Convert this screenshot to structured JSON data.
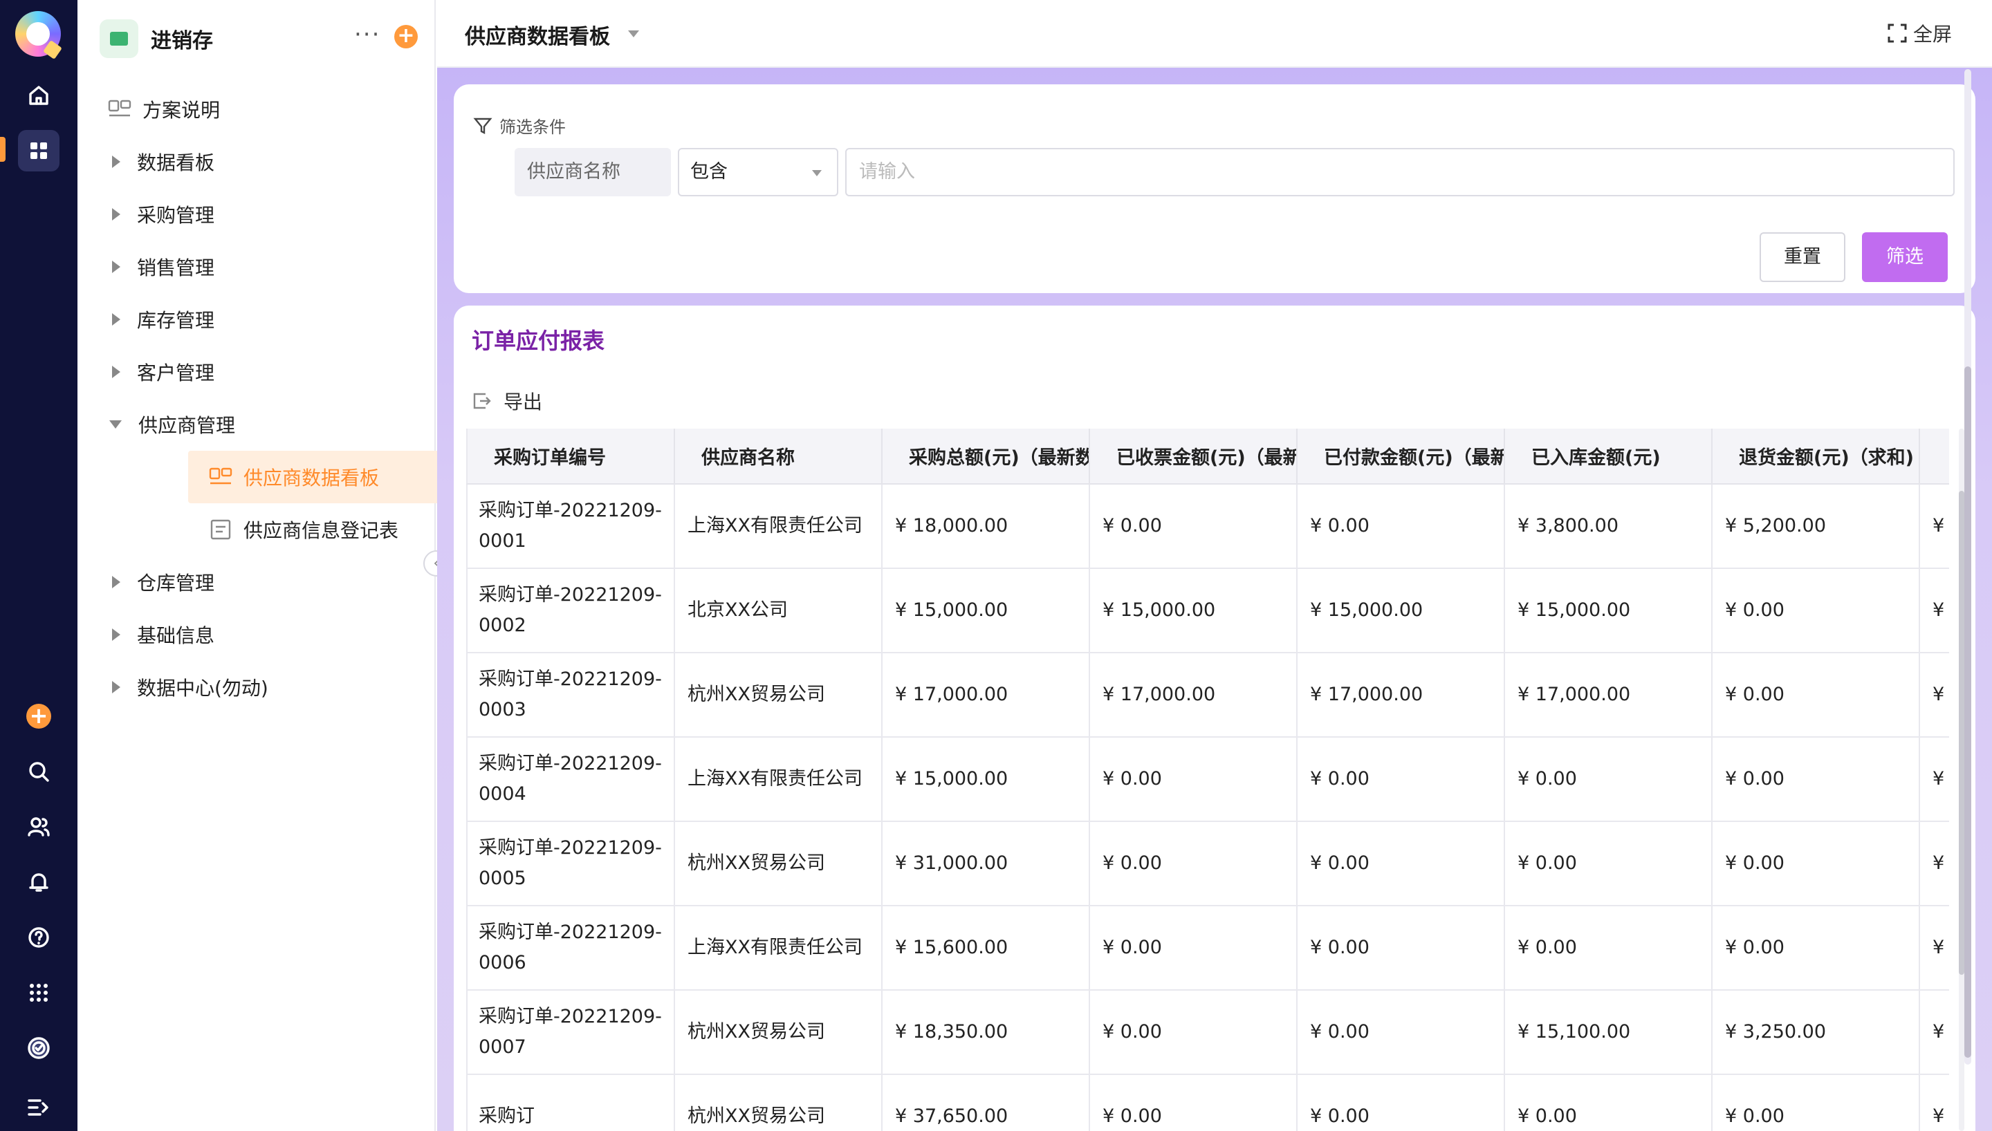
{
  "app": {
    "name": "进销存",
    "colors": {
      "accent": "#c16cf0",
      "orange": "#ff9a3c",
      "rail_bg": "#0f1238",
      "title_purple": "#7a22a6"
    }
  },
  "rail": {
    "icons": [
      "home-icon",
      "apps-icon",
      "add-icon",
      "search-icon",
      "users-icon",
      "bell-icon",
      "help-icon",
      "grid-icon",
      "check-circle-icon",
      "expand-menu-icon"
    ]
  },
  "nav": {
    "items": [
      {
        "label": "方案说明"
      },
      {
        "label": "数据看板"
      },
      {
        "label": "采购管理"
      },
      {
        "label": "销售管理"
      },
      {
        "label": "库存管理"
      },
      {
        "label": "客户管理"
      },
      {
        "label": "供应商管理"
      },
      {
        "label": "仓库管理"
      },
      {
        "label": "基础信息"
      },
      {
        "label": "数据中心(勿动)"
      }
    ],
    "sub_items": [
      {
        "label": "供应商数据看板"
      },
      {
        "label": "供应商信息登记表"
      }
    ]
  },
  "topbar": {
    "title": "供应商数据看板",
    "fullscreen_label": "全屏"
  },
  "filter": {
    "label": "筛选条件",
    "field_name": "供应商名称",
    "operator": "包含",
    "input_placeholder": "请输入",
    "reset_label": "重置",
    "apply_label": "筛选"
  },
  "report": {
    "title": "订单应付报表",
    "export_label": "导出",
    "columns": [
      "采购订单编号",
      "供应商名称",
      "采购总额(元)（最新数",
      "已收票金额(元)（最新",
      "已付款金额(元)（最新",
      "已入库金额(元)",
      "退货金额(元)（求和)"
    ],
    "rows": [
      [
        "采购订单-20221209-0001",
        "上海XX有限责任公司",
        "¥ 18,000.00",
        "¥ 0.00",
        "¥ 0.00",
        "¥ 3,800.00",
        "¥ 5,200.00",
        "¥"
      ],
      [
        "采购订单-20221209-0002",
        "北京XX公司",
        "¥ 15,000.00",
        "¥ 15,000.00",
        "¥ 15,000.00",
        "¥ 15,000.00",
        "¥ 0.00",
        "¥"
      ],
      [
        "采购订单-20221209-0003",
        "杭州XX贸易公司",
        "¥ 17,000.00",
        "¥ 17,000.00",
        "¥ 17,000.00",
        "¥ 17,000.00",
        "¥ 0.00",
        "¥"
      ],
      [
        "采购订单-20221209-0004",
        "上海XX有限责任公司",
        "¥ 15,000.00",
        "¥ 0.00",
        "¥ 0.00",
        "¥ 0.00",
        "¥ 0.00",
        "¥"
      ],
      [
        "采购订单-20221209-0005",
        "杭州XX贸易公司",
        "¥ 31,000.00",
        "¥ 0.00",
        "¥ 0.00",
        "¥ 0.00",
        "¥ 0.00",
        "¥"
      ],
      [
        "采购订单-20221209-0006",
        "上海XX有限责任公司",
        "¥ 15,600.00",
        "¥ 0.00",
        "¥ 0.00",
        "¥ 0.00",
        "¥ 0.00",
        "¥"
      ],
      [
        "采购订单-20221209-0007",
        "杭州XX贸易公司",
        "¥ 18,350.00",
        "¥ 0.00",
        "¥ 0.00",
        "¥ 15,100.00",
        "¥ 3,250.00",
        "¥"
      ],
      [
        "采购订",
        "杭州XX贸易公司",
        "¥ 37,650.00",
        "¥ 0.00",
        "¥ 0.00",
        "¥ 0.00",
        "¥ 0.00",
        "¥"
      ]
    ]
  }
}
